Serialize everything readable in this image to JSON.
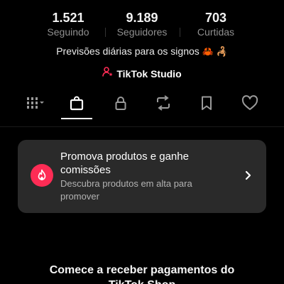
{
  "profile": {
    "stats": [
      {
        "value": "1.521",
        "label": "Seguindo"
      },
      {
        "value": "9.189",
        "label": "Seguidores"
      },
      {
        "value": "703",
        "label": "Curtidas"
      }
    ],
    "bio": "Previsões diárias para os signos",
    "bio_emojis": "🦀 🦂",
    "studio_label": "TikTok Studio"
  },
  "tabs": [
    {
      "icon": "grid-icon",
      "active": false
    },
    {
      "icon": "shop-bag-icon",
      "active": true
    },
    {
      "icon": "lock-icon",
      "active": false
    },
    {
      "icon": "repost-icon",
      "active": false
    },
    {
      "icon": "bookmark-icon",
      "active": false
    },
    {
      "icon": "heart-icon",
      "active": false
    }
  ],
  "promo": {
    "title": "Promova produtos e ganhe comissões",
    "subtitle": "Descubra produtos em alta para promover",
    "icon": "flame-icon",
    "accent": "#fe2c55"
  },
  "bottom": {
    "title_line1": "Comece a receber pagamentos do",
    "title_line2": "TikTok Shop"
  },
  "colors": {
    "background": "#000000",
    "card": "#2a2a2a",
    "muted_text": "#8f8f8f"
  }
}
